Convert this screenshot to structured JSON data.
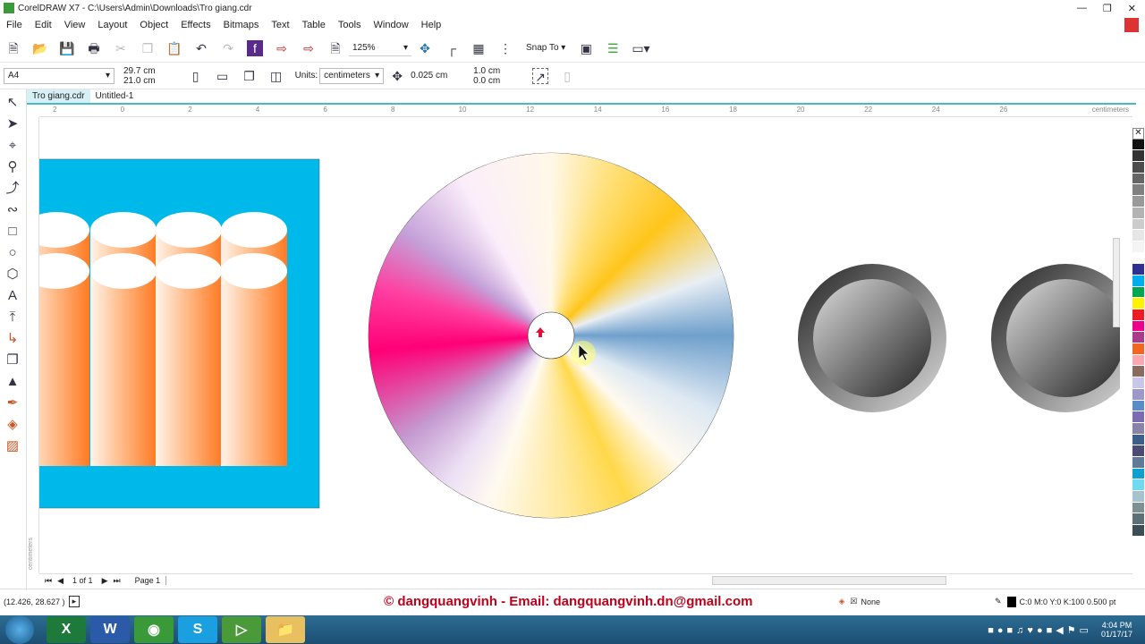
{
  "window": {
    "title": "CorelDRAW X7 - C:\\Users\\Admin\\Downloads\\Tro giang.cdr",
    "controls": [
      "minimize",
      "restore",
      "close"
    ]
  },
  "menu": [
    "File",
    "Edit",
    "View",
    "Layout",
    "Object",
    "Effects",
    "Bitmaps",
    "Text",
    "Table",
    "Tools",
    "Window",
    "Help"
  ],
  "toolbar": {
    "zoom": "125%",
    "snap_to": "Snap To"
  },
  "propbar": {
    "page_size": "A4",
    "width": "29.7 cm",
    "height": "21.0 cm",
    "units_label": "Units:",
    "units": "centimeters",
    "nudge": "0.025 cm",
    "dup_x": "1.0 cm",
    "dup_y": "0.0 cm"
  },
  "tabs": [
    {
      "label": "Tro giang.cdr",
      "active": true
    },
    {
      "label": "Untitled-1",
      "active": false
    }
  ],
  "ruler": {
    "labels": [
      "2",
      "0",
      "2",
      "4",
      "6",
      "8",
      "10",
      "12",
      "14",
      "16",
      "18",
      "20",
      "22",
      "24",
      "26"
    ],
    "unit": "centimeters",
    "vunit": "centimeters"
  },
  "pagenav": {
    "count": "1 of 1",
    "page": "Page 1"
  },
  "status": {
    "coords": "(12.426, 28.627 )",
    "watermark": "© dangquangvinh - Email: dangquangvinh.dn@gmail.com",
    "fill": "None",
    "outline": "C:0 M:0 Y:0 K:100  0.500 pt"
  },
  "taskbar": {
    "time": "4:04 PM",
    "date": "01/17/17",
    "apps": [
      "windows-start",
      "excel",
      "word",
      "coccoc",
      "skype",
      "coreldraw",
      "file-explorer"
    ]
  },
  "palette": [
    "#111111",
    "#333333",
    "#4d4d4d",
    "#666666",
    "#808080",
    "#999999",
    "#b3b3b3",
    "#cccccc",
    "#e6e6e6",
    "#f4f4f4",
    "#ffffff",
    "#2e3192",
    "#00aeef",
    "#00a651",
    "#fff200",
    "#ed1c24",
    "#ec008c",
    "#a93b8a",
    "#f26522",
    "#f9a7b0",
    "#8b6a60",
    "#c9c7e8",
    "#9e97cb",
    "#5b8cc8",
    "#7b6cb1",
    "#8b82a8",
    "#3b5f8a",
    "#4d4a73",
    "#5e7a96",
    "#0fa0d0",
    "#6fd9f0",
    "#a3c4cc",
    "#7d9195",
    "#5d7077",
    "#3b4e55"
  ],
  "colors": {
    "cyan_bg": "#00b9eb",
    "orange": "#ff7f2a",
    "watermark": "#c0001a"
  }
}
